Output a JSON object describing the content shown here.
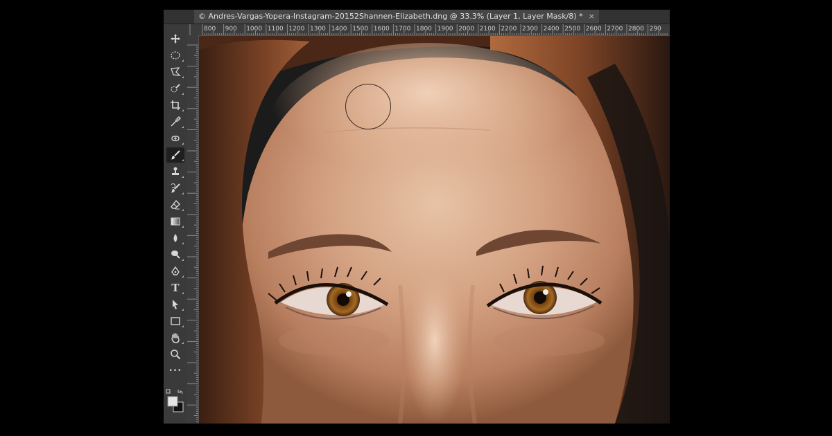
{
  "document_tab": {
    "title": "© Andres-Vargas-Yopera-Instagram-20152Shannen-Elizabeth.dng @ 33.3% (Layer 1, Layer Mask/8) *",
    "close_glyph": "×"
  },
  "ruler": {
    "horizontal_labels": [
      "800",
      "900",
      "1000",
      "1100",
      "1200",
      "1300",
      "1400",
      "1500",
      "1600",
      "1700",
      "1800",
      "1900",
      "2000",
      "2100",
      "2200",
      "2300",
      "2400",
      "2500",
      "2600",
      "2700",
      "2800",
      "290"
    ]
  },
  "tools": [
    {
      "name": "move-tool",
      "icon": "move-icon"
    },
    {
      "name": "elliptical-marquee-tool",
      "icon": "ellipse-marquee-icon"
    },
    {
      "name": "polygonal-lasso-tool",
      "icon": "lasso-icon"
    },
    {
      "name": "quick-selection-tool",
      "icon": "quick-selection-icon"
    },
    {
      "name": "crop-tool",
      "icon": "crop-icon"
    },
    {
      "name": "eyedropper-tool",
      "icon": "eyedropper-icon"
    },
    {
      "name": "spot-healing-tool",
      "icon": "healing-icon"
    },
    {
      "name": "brush-tool",
      "icon": "brush-icon",
      "active": true
    },
    {
      "name": "clone-stamp-tool",
      "icon": "stamp-icon"
    },
    {
      "name": "history-brush-tool",
      "icon": "history-brush-icon"
    },
    {
      "name": "eraser-tool",
      "icon": "eraser-icon"
    },
    {
      "name": "gradient-tool",
      "icon": "gradient-icon"
    },
    {
      "name": "blur-tool",
      "icon": "blur-icon"
    },
    {
      "name": "dodge-tool",
      "icon": "dodge-icon"
    },
    {
      "name": "pen-tool",
      "icon": "pen-icon"
    },
    {
      "name": "type-tool",
      "icon": "type-icon",
      "label": "T"
    },
    {
      "name": "path-selection-tool",
      "icon": "arrow-icon"
    },
    {
      "name": "rectangle-tool",
      "icon": "rectangle-icon"
    },
    {
      "name": "hand-tool",
      "icon": "hand-icon"
    },
    {
      "name": "zoom-tool",
      "icon": "zoom-icon"
    },
    {
      "name": "more-tools",
      "icon": "more-icon",
      "label": "•••"
    }
  ],
  "colors": {
    "foreground": "#e6e6e6",
    "background": "#111111",
    "ui_dark": "#2b2b2b",
    "toolbar": "#3a3a3a"
  }
}
